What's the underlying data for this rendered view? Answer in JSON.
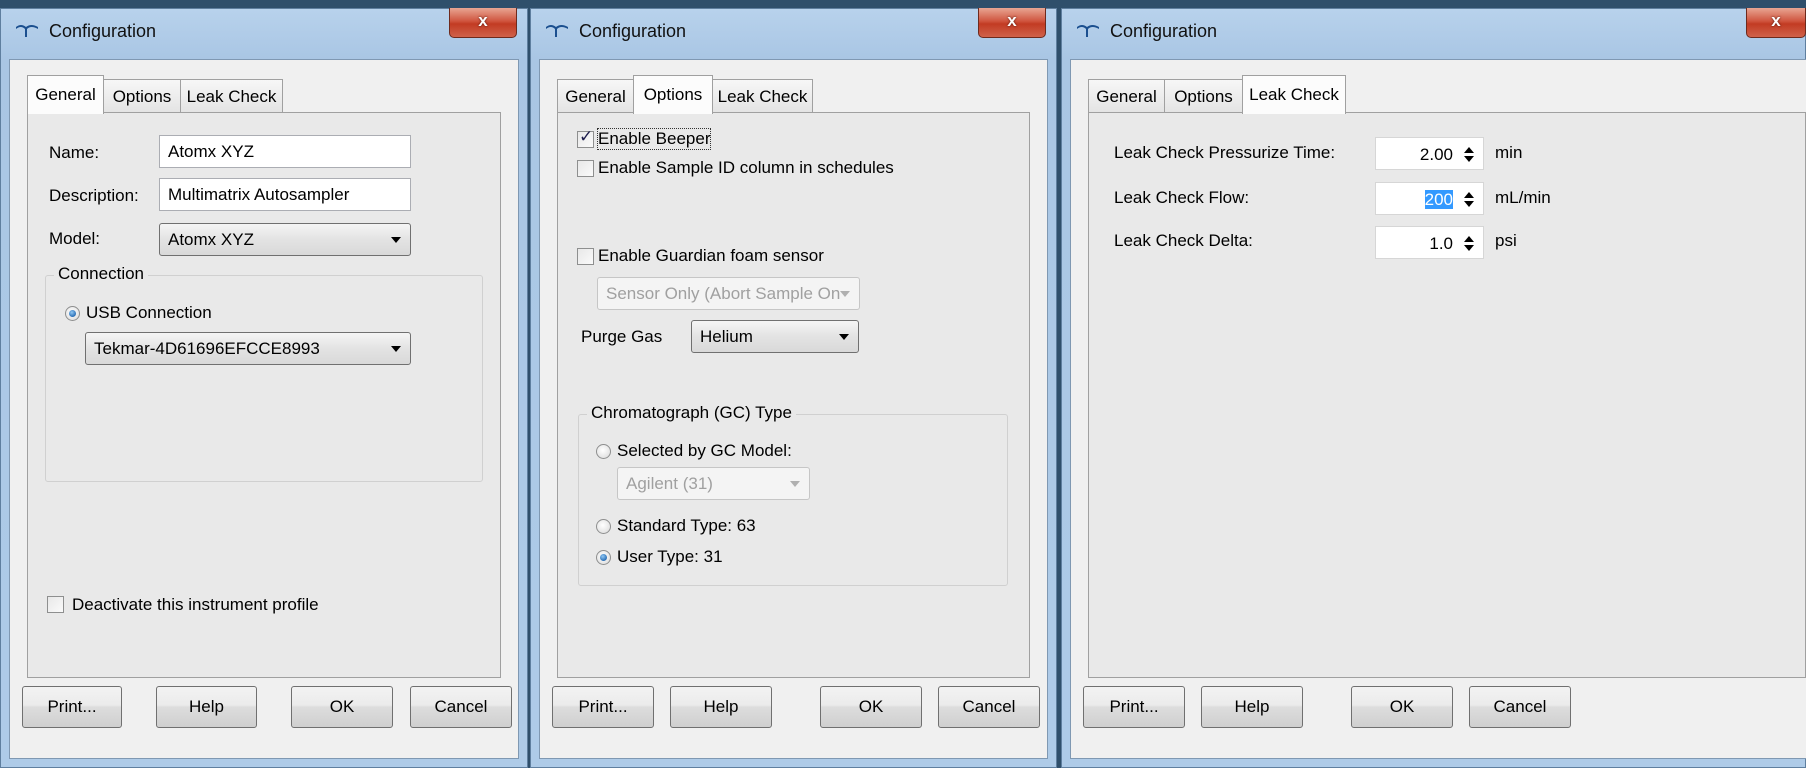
{
  "windows": [
    {
      "title": "Configuration",
      "close_label": "x",
      "tabs": [
        "General",
        "Options",
        "Leak Check"
      ],
      "active_tab": "General",
      "general": {
        "name_label": "Name:",
        "name_value": "Atomx XYZ",
        "description_label": "Description:",
        "description_value": "Multimatrix Autosampler",
        "model_label": "Model:",
        "model_value": "Atomx XYZ",
        "connection_group": "Connection",
        "usb_label": "USB Connection",
        "usb_selected": true,
        "usb_device": "Tekmar-4D61696EFCCE8993",
        "deactivate_label": "Deactivate this instrument profile",
        "deactivate_checked": false
      },
      "buttons": {
        "print": "Print...",
        "help": "Help",
        "ok": "OK",
        "cancel": "Cancel"
      }
    },
    {
      "title": "Configuration",
      "close_label": "x",
      "tabs": [
        "General",
        "Options",
        "Leak Check"
      ],
      "active_tab": "Options",
      "options": {
        "enable_beeper_label": "Enable Beeper",
        "enable_beeper_checked": true,
        "enable_sample_id_label": "Enable Sample ID column in schedules",
        "enable_sample_id_checked": false,
        "enable_guardian_label": "Enable Guardian foam sensor",
        "enable_guardian_checked": false,
        "guardian_mode_value": "Sensor Only (Abort Sample On",
        "purge_gas_label": "Purge Gas",
        "purge_gas_value": "Helium",
        "gc_group": "Chromatograph (GC) Type",
        "selected_by_gc_label": "Selected by GC Model:",
        "gc_model_value": "Agilent (31)",
        "standard_type_label": "Standard Type: 63",
        "user_type_label": "User Type: 31",
        "gc_type_selected": "User Type: 31"
      },
      "buttons": {
        "print": "Print...",
        "help": "Help",
        "ok": "OK",
        "cancel": "Cancel"
      }
    },
    {
      "title": "Configuration",
      "close_label": "x",
      "tabs": [
        "General",
        "Options",
        "Leak Check"
      ],
      "active_tab": "Leak Check",
      "leak_check": {
        "pressurize_time_label": "Leak Check Pressurize Time:",
        "pressurize_time_value": "2.00",
        "pressurize_time_unit": "min",
        "flow_label": "Leak Check Flow:",
        "flow_value": "200",
        "flow_unit": "mL/min",
        "delta_label": "Leak Check Delta:",
        "delta_value": "1.0",
        "delta_unit": "psi"
      },
      "buttons": {
        "print": "Print...",
        "help": "Help",
        "ok": "OK",
        "cancel": "Cancel"
      }
    }
  ],
  "colors": {
    "title_gradient_top": "#b8d2ec",
    "close_button_red": "#c23b23",
    "client_background": "#f0f0f0",
    "selection_blue": "#3399ff"
  }
}
